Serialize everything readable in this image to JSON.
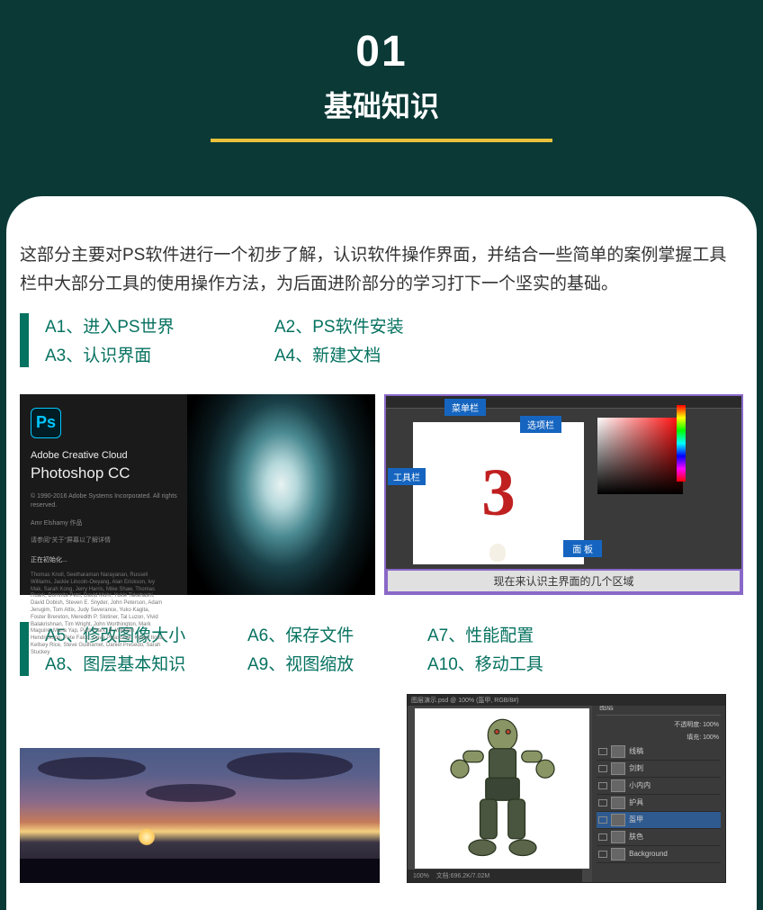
{
  "header": {
    "number": "01",
    "title": "基础知识"
  },
  "description": "这部分主要对PS软件进行一个初步了解，认识软件操作界面，并结合一些简单的案例掌握工具栏中大部分工具的使用操作方法，为后面进阶部分的学习打下一个坚实的基础。",
  "topic_group_1": [
    {
      "label": "A1、进入PS世界"
    },
    {
      "label": "A2、PS软件安装"
    },
    {
      "label": "A3、认识界面"
    },
    {
      "label": "A4、新建文档"
    }
  ],
  "topic_group_2": [
    {
      "label": "A5、修改图像大小"
    },
    {
      "label": "A6、保存文件"
    },
    {
      "label": "A7、性能配置"
    },
    {
      "label": "A8、图层基本知识"
    },
    {
      "label": "A9、视图缩放"
    },
    {
      "label": "A10、移动工具"
    }
  ],
  "splash": {
    "badge": "Ps",
    "line1": "Adobe Creative Cloud",
    "line2": "Photoshop CC",
    "copyright": "© 1990-2016 Adobe Systems Incorporated.\nAll rights reserved.",
    "author": "Amr Elshamy 作品",
    "reading": "请参阅\"关于\"屏幕以了解详情",
    "init": "正在初始化...",
    "credits": "Thomas Knoll, Seetharaman Narayanan, Russell Williams, Jackie Lincoln-Owyang, Alan Erickson, Ivy Mak, Sarah Kong, Jerry Harris, Mike Shaw, Thomas Ruark, Domnita Petri, David Mohr, Yukie Takahashi, David Dobish, Steven E. Snyder, John Peterson, Adam Jerugim, Tom Attix, Judy Severance, Yuko Kagita, Foster Brereton, Meredith P. Slotiner, Tal Luzon, Vivid Balakrishnan, Tim Wright, John Worthington, Mark Maguire, Maria Yap, Pam Clark, B. Winston Hendrickson, Pete Falco, Dave Polaschek, Kyoko Itoda, Kellsey Rice, Steve Guilhamet, Daniel Presedo, Sarah Stuckey"
  },
  "psui": {
    "menu_label": "菜单栏",
    "options_label": "选项栏",
    "tools_label": "工具栏",
    "panel_label": "面  板",
    "canvas_text": "3",
    "footer": "现在来认识主界面的几个区域"
  },
  "layer_panel": {
    "title": "图层演示.psd @ 100% (盔甲, RGB/8#)",
    "tab": "图层",
    "opacity_label": "不透明度: 100%",
    "fill_label": "填充: 100%",
    "layers": [
      {
        "name": "线稿"
      },
      {
        "name": "剑刺"
      },
      {
        "name": "小内内"
      },
      {
        "name": "护具"
      },
      {
        "name": "盔甲",
        "selected": true
      },
      {
        "name": "肤色"
      },
      {
        "name": "Background"
      }
    ],
    "zoom": "100%",
    "doc_info": "文档:696.2K/7.02M"
  }
}
